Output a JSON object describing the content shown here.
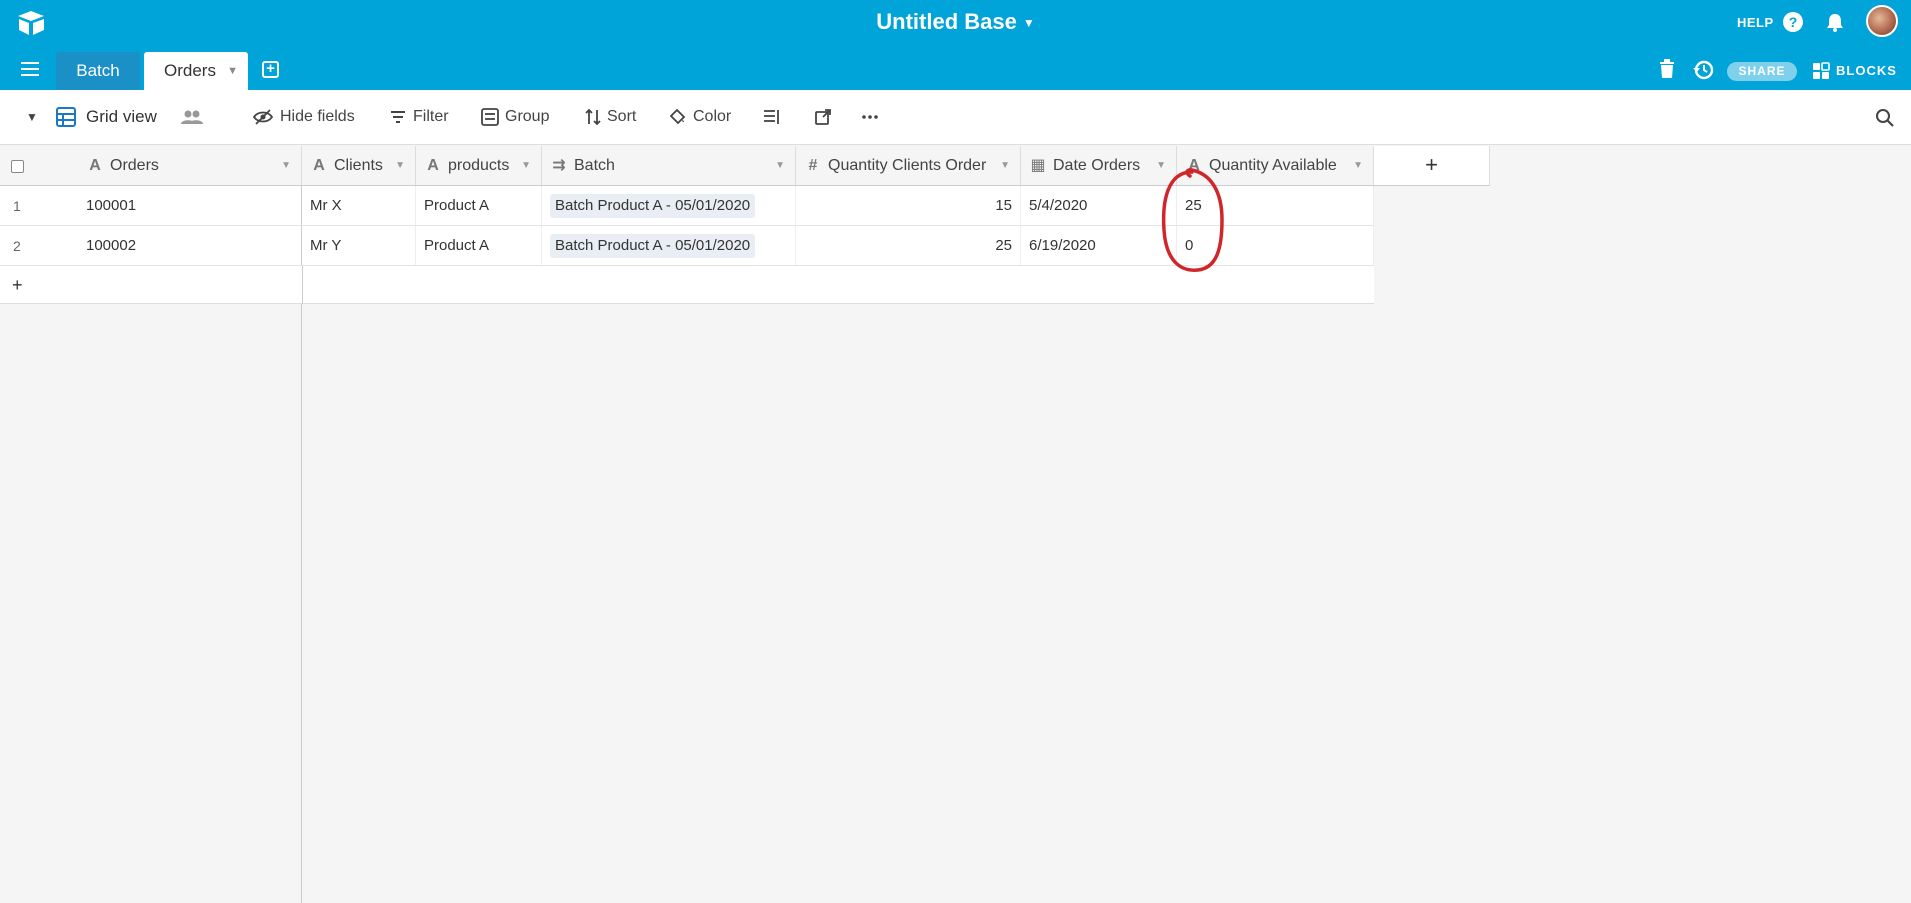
{
  "app": {
    "base_title": "Untitled Base",
    "help_label": "HELP",
    "share_label": "SHARE",
    "blocks_label": "BLOCKS",
    "accent": "#00a4d8"
  },
  "tabs": [
    {
      "label": "Batch",
      "active": false
    },
    {
      "label": "Orders",
      "active": true
    }
  ],
  "toolbar": {
    "view_name": "Grid view",
    "hide_fields": "Hide fields",
    "filter": "Filter",
    "group": "Group",
    "sort": "Sort",
    "color": "Color"
  },
  "columns": [
    {
      "label": "Orders",
      "icon": "text-field-icon"
    },
    {
      "label": "Clients",
      "icon": "text-field-icon"
    },
    {
      "label": "products",
      "icon": "text-field-icon"
    },
    {
      "label": "Batch",
      "icon": "link-field-icon"
    },
    {
      "label": "Quantity Clients Order",
      "icon": "number-field-icon"
    },
    {
      "label": "Date Orders",
      "icon": "date-field-icon"
    },
    {
      "label": "Quantity Available",
      "icon": "text-field-icon"
    }
  ],
  "rows": [
    {
      "num": "1",
      "orders": "100001",
      "clients": "Mr X",
      "products": "Product A",
      "batch": "Batch Product A - 05/01/2020",
      "qty_order": "15",
      "date": "5/4/2020",
      "qty_available": "25"
    },
    {
      "num": "2",
      "orders": "100002",
      "clients": "Mr Y",
      "products": "Product A",
      "batch": "Batch Product A - 05/01/2020",
      "qty_order": "25",
      "date": "6/19/2020",
      "qty_available": "0"
    }
  ],
  "add_row_label": "+",
  "add_column_label": "+",
  "annotation_color": "#d0262b"
}
